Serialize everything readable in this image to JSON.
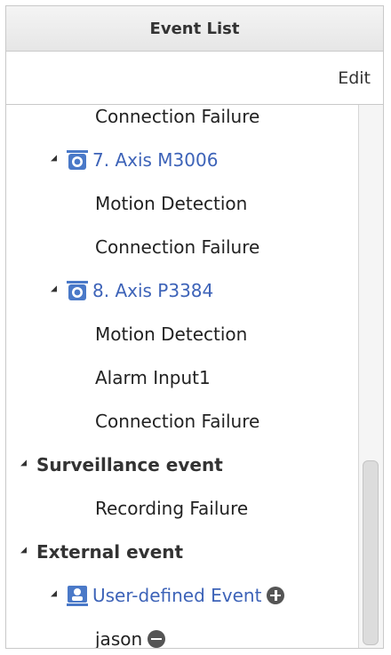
{
  "header": {
    "title": "Event List"
  },
  "toolbar": {
    "edit_label": "Edit"
  },
  "tree": {
    "items": [
      {
        "label": "Connection Failure"
      },
      {
        "label": "7. Axis M3006",
        "icon": "camera-icon"
      },
      {
        "label": "Motion Detection"
      },
      {
        "label": "Connection Failure"
      },
      {
        "label": "8. Axis P3384",
        "icon": "camera-icon"
      },
      {
        "label": "Motion Detection"
      },
      {
        "label": "Alarm Input1"
      },
      {
        "label": "Connection Failure"
      },
      {
        "label": "Surveillance event"
      },
      {
        "label": "Recording Failure"
      },
      {
        "label": "External event"
      },
      {
        "label": "User-defined Event",
        "icon": "user-event-icon",
        "action": "add-icon"
      },
      {
        "label": "jason",
        "action": "remove-icon"
      }
    ]
  },
  "colors": {
    "link": "#3d63b8",
    "camera_icon": "#4a79c8",
    "header_bg": "#e9e9e9"
  }
}
